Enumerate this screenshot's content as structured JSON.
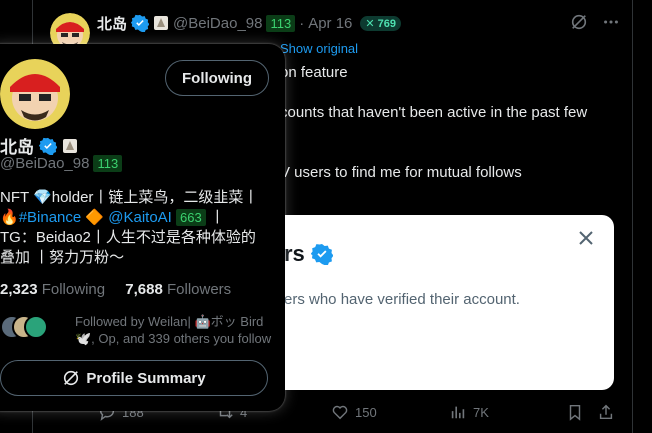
{
  "tweet": {
    "author_name": "北岛",
    "author_handle": "@BeiDao_98",
    "level_badge": "113",
    "date": "Apr 16",
    "x_badge": "✕ 769",
    "show_original": "Show original",
    "lines": [
      "on feature",
      "counts that haven't been active in the past few",
      "V users to find me for mutual follows"
    ],
    "card": {
      "title_fragment": "rs",
      "text_fragment": "ers who have verified their account."
    },
    "actions": {
      "replies": "188",
      "reposts": "4",
      "likes": "150",
      "views": "7K"
    }
  },
  "hover_card": {
    "follow_button": "Following",
    "name": "北岛",
    "handle": "@BeiDao_98",
    "level_badge": "113",
    "bio": {
      "line1": "NFT 💎holder丨链上菜鸟，二级韭菜丨",
      "binance_prefix": "🔥",
      "binance": "#Binance",
      "binance_suffix": " 🔶 ",
      "kaito": "@KaitoAI",
      "kaito_badge": "663",
      "line2_end": " 丨",
      "line3": "TG：Beidao2丨人生不过是各种体验的",
      "line4": "叠加 丨努力万粉～"
    },
    "stats": {
      "following_count": "2,323",
      "following_label": "Following",
      "followers_count": "7,688",
      "followers_label": "Followers"
    },
    "followed_by": "Followed by Weilan| 🤖ボッ Bird 🕊️, Op, and 339 others you follow",
    "summary_button": "Profile Summary"
  },
  "colors": {
    "accent": "#1d9bf0",
    "background": "#000000",
    "muted": "#71767b",
    "level_green": "#3bd16f"
  }
}
